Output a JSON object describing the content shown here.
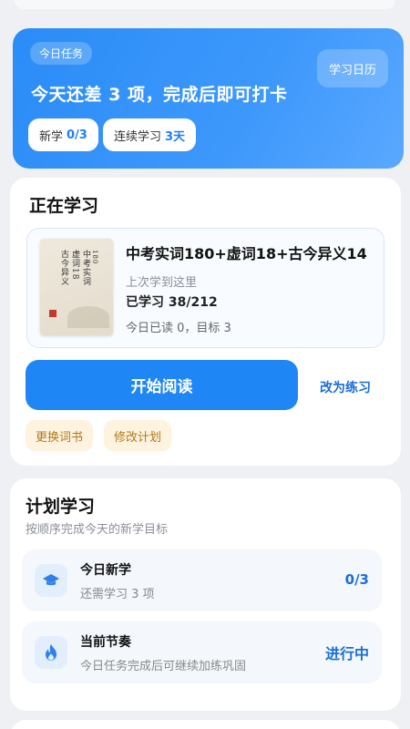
{
  "banner": {
    "tag": "今日任务",
    "title": "今天还差 3 项，完成后即可打卡",
    "calendar_label": "学习日历",
    "new_label": "新学",
    "new_value": "0/3",
    "streak_label": "连续学习",
    "streak_value": "3天"
  },
  "studying": {
    "section_title": "正在学习",
    "book_title": "中考实词180+虚词18+古今异义14",
    "cover_lines": [
      "中考实词",
      "虚词18",
      "古今异义",
      "180"
    ],
    "last_read": "上次学到这里",
    "learned": "已学习 38/212",
    "today_read": "今日已读 0，目标 3",
    "start_label": "开始阅读",
    "practice_label": "改为练习",
    "change_book_label": "更换词书",
    "edit_plan_label": "修改计划"
  },
  "plan": {
    "section_title": "计划学习",
    "subtitle": "按顺序完成今天的新学目标",
    "rows": [
      {
        "title": "今日新学",
        "sub": "还需学习 3 项",
        "value": "0/3",
        "icon": "graduation-cap-icon"
      },
      {
        "title": "当前节奏",
        "sub": "今日任务完成后可继续加练巩固",
        "value": "进行中",
        "icon": "flame-icon"
      }
    ]
  },
  "colors": {
    "accent": "#1f86f5",
    "banner": "#2a8cf7",
    "pill_bg": "#fdf3df",
    "pill_text": "#b07a1a"
  }
}
